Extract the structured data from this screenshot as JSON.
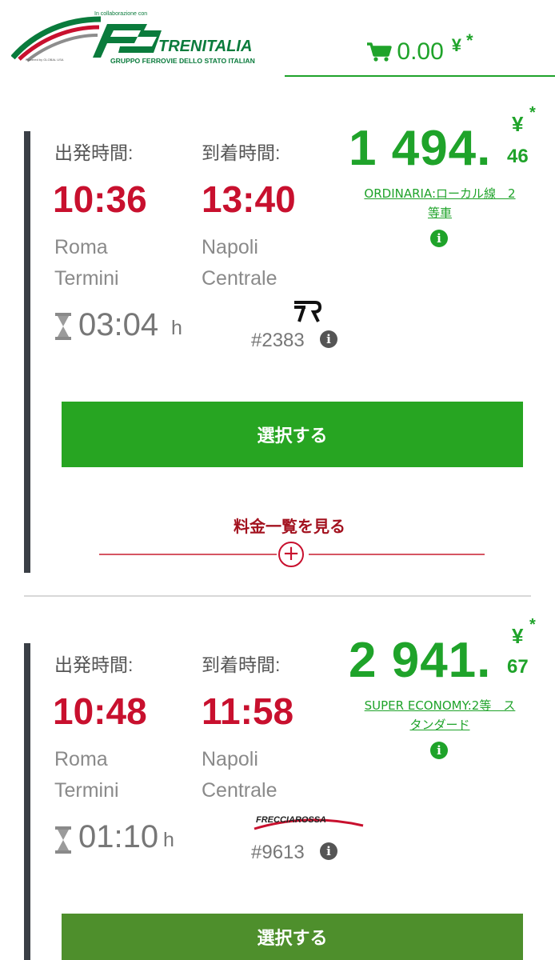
{
  "header": {
    "logo": {
      "collab_text": "In collaborazione con",
      "brand": "TRENITALIA",
      "subtitle": "GRUPPO FERROVIE DELLO STATO ITALIANE",
      "powered_by": "Powered by GLOBAL USA"
    },
    "cart": {
      "icon": "cart-icon",
      "amount": "0.00",
      "currency": "¥",
      "star": "*"
    }
  },
  "results": [
    {
      "departure_label": "出発時間:",
      "arrival_label": "到着時間:",
      "departure_time": "10:36",
      "arrival_time": "13:40",
      "departure_station_line1": "Roma",
      "departure_station_line2": "Termini",
      "arrival_station_line1": "Napoli",
      "arrival_station_line2": "Centrale",
      "duration": "03:04",
      "duration_unit": "h",
      "train_logo": "regionale-R-logo",
      "train_number": "#2383",
      "price_integer": "1 494.",
      "price_cents": "46",
      "currency": "¥",
      "star": "*",
      "fare_line1": "ORDINARIA:ローカル線　2",
      "fare_line2": "等車",
      "select_label": "選択する",
      "more_fares_label": "料金一覧を見る",
      "more_icon": "plus-circle-icon"
    },
    {
      "departure_label": "出発時間:",
      "arrival_label": "到着時間:",
      "departure_time": "10:48",
      "arrival_time": "11:58",
      "departure_station_line1": "Roma",
      "departure_station_line2": "Termini",
      "arrival_station_line1": "Napoli",
      "arrival_station_line2": "Centrale",
      "duration": "01:10",
      "duration_unit": "h",
      "train_logo_text": "FRECCIAROSSA",
      "train_number": "#9613",
      "price_integer": "2 941.",
      "price_cents": "67",
      "currency": "¥",
      "star": "*",
      "fare_line1": "SUPER ECONOMY:2等　ス",
      "fare_line2": "タンダード",
      "select_label": "選択する"
    }
  ],
  "colors": {
    "green": "#1fa32a",
    "red": "#c8102e",
    "button_green": "#27a522"
  }
}
